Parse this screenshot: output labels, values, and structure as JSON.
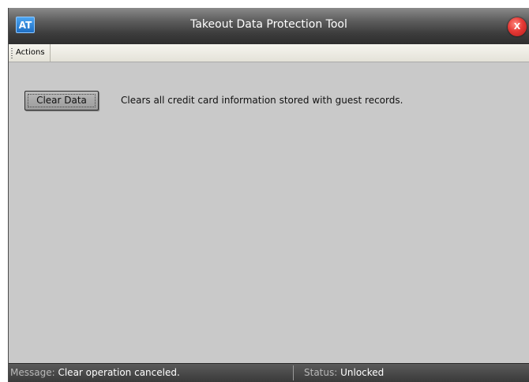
{
  "window": {
    "app_icon_text": "AT",
    "title": "Takeout Data Protection Tool",
    "close_label": "X"
  },
  "menu": {
    "items": [
      {
        "label": "Actions"
      }
    ]
  },
  "main": {
    "clear_button_label": "Clear Data",
    "clear_description": "Clears all credit card information stored with guest records."
  },
  "status_bar": {
    "message_label": "Message:",
    "message_value": "Clear operation canceled.",
    "status_label": "Status:",
    "status_value": "Unlocked"
  },
  "colors": {
    "background": "#c9c9c9",
    "titlebar": "#3d3d3d",
    "close_button": "#e53935",
    "app_icon": "#1f6fc4",
    "status_bar": "#3a3a3a"
  },
  "icons": {
    "app": "app-logo-icon",
    "close": "close-icon",
    "grip": "toolbar-grip-icon"
  }
}
